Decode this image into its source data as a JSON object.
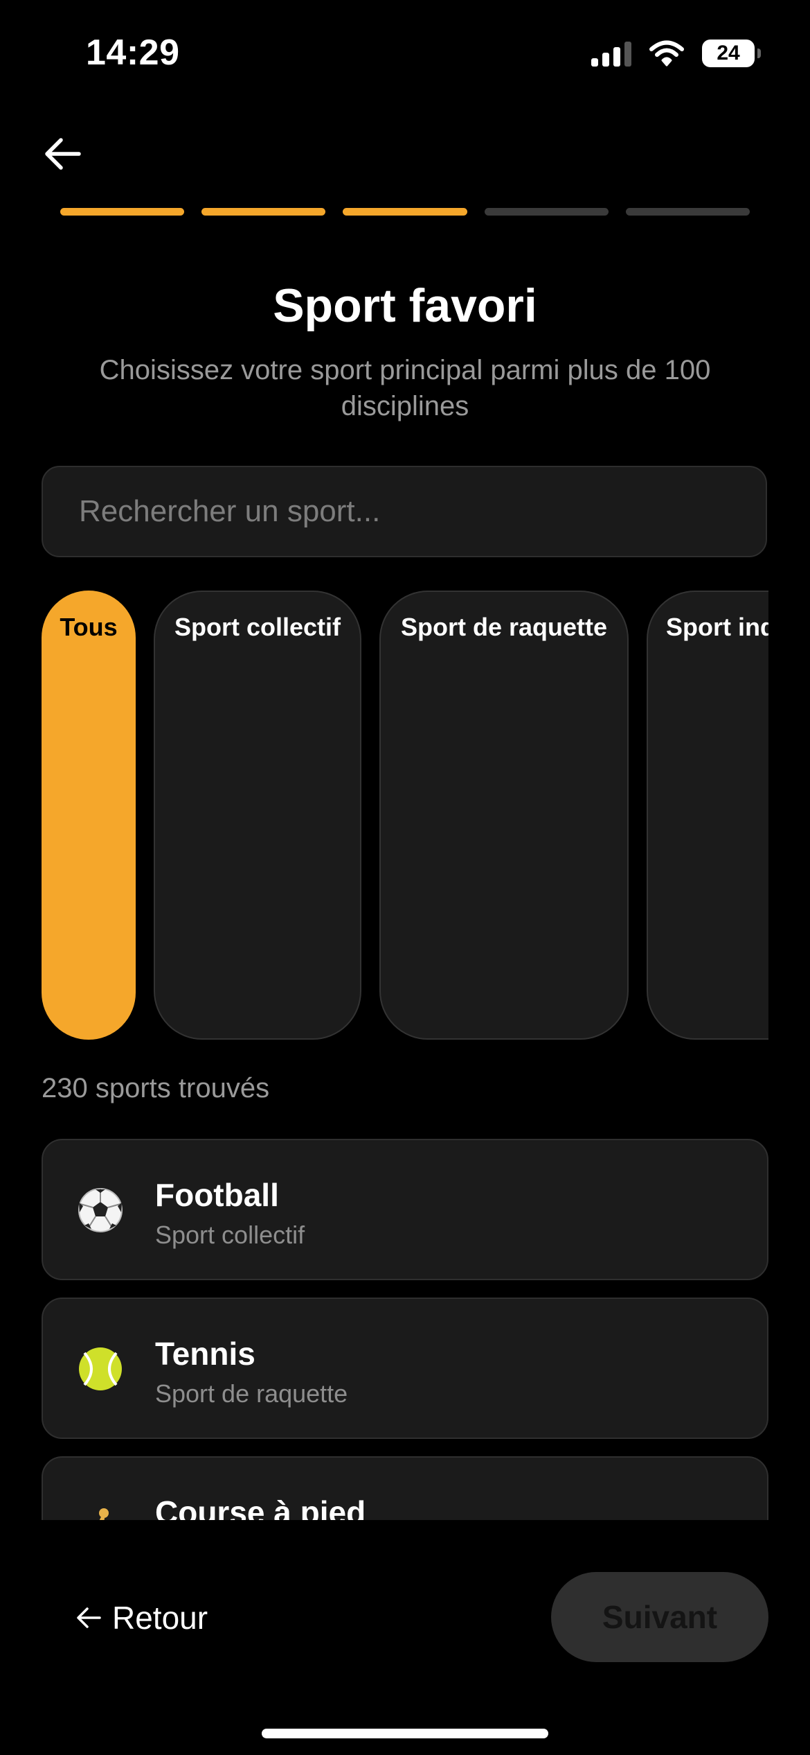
{
  "status_bar": {
    "time": "14:29",
    "battery": "24",
    "icons": [
      "signal-icon",
      "wifi-icon",
      "battery-icon"
    ]
  },
  "progress": {
    "total_steps": 5,
    "completed_steps": 3,
    "active_color": "#f5a72b",
    "inactive_color": "#3a3a3a"
  },
  "header": {
    "title": "Sport favori",
    "subtitle": "Choisissez votre sport principal parmi plus de 100 disciplines"
  },
  "search": {
    "placeholder": "Rechercher un sport...",
    "value": ""
  },
  "filters": {
    "selected": "Tous",
    "items": [
      {
        "label": "Tous",
        "active": true
      },
      {
        "label": "Sport collectif",
        "active": false
      },
      {
        "label": "Sport de raquette",
        "active": false
      },
      {
        "label": "Sport ind",
        "active": false
      }
    ]
  },
  "results": {
    "count_text": "230 sports trouvés",
    "items": [
      {
        "name": "Football",
        "category": "Sport collectif",
        "icon": "soccer-ball-icon"
      },
      {
        "name": "Tennis",
        "category": "Sport de raquette",
        "icon": "tennis-ball-icon"
      },
      {
        "name": "Course à pied",
        "category": "",
        "icon": "runner-icon"
      }
    ]
  },
  "footer": {
    "back_label": "Retour",
    "next_label": "Suivant"
  },
  "colors": {
    "accent": "#f5a72b",
    "background": "#000000",
    "card": "#1b1b1b",
    "muted_text": "#9a9a9a"
  }
}
